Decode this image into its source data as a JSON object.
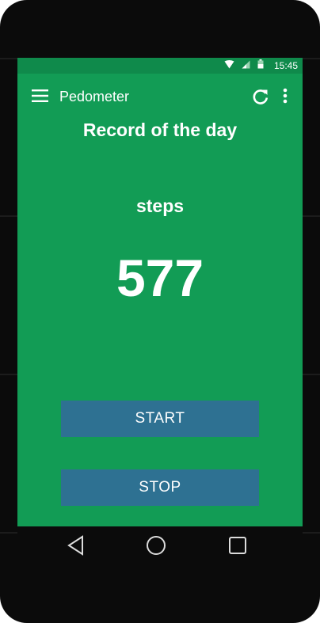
{
  "status_bar": {
    "time": "15:45",
    "icons": [
      "wifi-icon",
      "signal-icon",
      "battery-icon"
    ]
  },
  "app_bar": {
    "title": "Pedometer",
    "icons": [
      "menu-icon",
      "refresh-icon",
      "more-vert-icon"
    ]
  },
  "main": {
    "record_title": "Record of the day",
    "steps_label": "steps",
    "steps_value": "577"
  },
  "buttons": {
    "start_label": "START",
    "stop_label": "STOP"
  },
  "nav_bar": {
    "icons": [
      "back-icon",
      "home-icon",
      "recents-icon"
    ]
  },
  "colors": {
    "background": "#129c55",
    "status_bar": "#0f8a4b",
    "button": "#2e7192",
    "text": "#ffffff"
  }
}
